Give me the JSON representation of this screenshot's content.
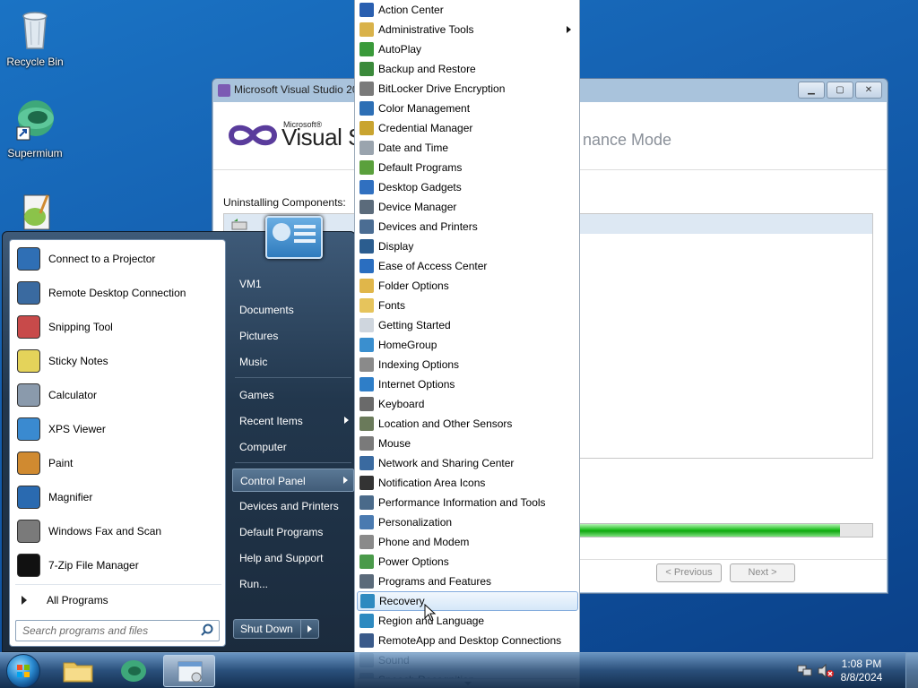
{
  "desktop": {
    "icons": [
      {
        "label": "Recycle Bin",
        "icon": "recycle-bin-icon"
      },
      {
        "label": "Supermium",
        "icon": "supermium-icon"
      }
    ]
  },
  "vs_window": {
    "title": "Microsoft Visual Studio 20",
    "logo_sup": "Microsoft®",
    "logo_text": "Visual St",
    "mode_text": "nance Mode",
    "section_label": "Uninstalling Components:",
    "progress": 0.95,
    "prev_button": "< Previous",
    "next_button": "Next >"
  },
  "start_menu": {
    "programs": [
      {
        "label": "Connect to a Projector",
        "icon": "projector-icon"
      },
      {
        "label": "Remote Desktop Connection",
        "icon": "remote-desktop-icon"
      },
      {
        "label": "Snipping Tool",
        "icon": "scissors-icon"
      },
      {
        "label": "Sticky Notes",
        "icon": "sticky-notes-icon"
      },
      {
        "label": "Calculator",
        "icon": "calculator-icon"
      },
      {
        "label": "XPS Viewer",
        "icon": "xps-viewer-icon"
      },
      {
        "label": "Paint",
        "icon": "paint-icon"
      },
      {
        "label": "Magnifier",
        "icon": "magnifier-icon"
      },
      {
        "label": "Windows Fax and Scan",
        "icon": "fax-icon"
      },
      {
        "label": "7-Zip File Manager",
        "icon": "7zip-icon"
      }
    ],
    "all_programs": "All Programs",
    "search_placeholder": "Search programs and files",
    "right_items": [
      {
        "label": "VM1"
      },
      {
        "label": "Documents"
      },
      {
        "label": "Pictures"
      },
      {
        "label": "Music"
      },
      {
        "label": "Games"
      },
      {
        "label": "Recent Items"
      },
      {
        "label": "Computer"
      },
      {
        "label": "Control Panel"
      },
      {
        "label": "Devices and Printers"
      },
      {
        "label": "Default Programs"
      },
      {
        "label": "Help and Support"
      },
      {
        "label": "Run..."
      }
    ],
    "shutdown": "Shut Down"
  },
  "control_panel_menu": {
    "items": [
      {
        "label": "Action Center",
        "color": "#2a5fb0"
      },
      {
        "label": "Administrative Tools",
        "color": "#d9b24a"
      },
      {
        "label": "AutoPlay",
        "color": "#3a9a3a"
      },
      {
        "label": "Backup and Restore",
        "color": "#3b8a3b"
      },
      {
        "label": "BitLocker Drive Encryption",
        "color": "#7a7a7a"
      },
      {
        "label": "Color Management",
        "color": "#2d6fb5"
      },
      {
        "label": "Credential Manager",
        "color": "#c9a430"
      },
      {
        "label": "Date and Time",
        "color": "#9aa4ae"
      },
      {
        "label": "Default Programs",
        "color": "#5aa03c"
      },
      {
        "label": "Desktop Gadgets",
        "color": "#3070c0"
      },
      {
        "label": "Device Manager",
        "color": "#5b6b7b"
      },
      {
        "label": "Devices and Printers",
        "color": "#4b6d93"
      },
      {
        "label": "Display",
        "color": "#2b5d8f"
      },
      {
        "label": "Ease of Access Center",
        "color": "#2a6ec0"
      },
      {
        "label": "Folder Options",
        "color": "#e0b64a"
      },
      {
        "label": "Fonts",
        "color": "#e6c45c"
      },
      {
        "label": "Getting Started",
        "color": "#cfd6de"
      },
      {
        "label": "HomeGroup",
        "color": "#3a8fcf"
      },
      {
        "label": "Indexing Options",
        "color": "#8a8a8a"
      },
      {
        "label": "Internet Options",
        "color": "#2e7ec8"
      },
      {
        "label": "Keyboard",
        "color": "#6a6a6a"
      },
      {
        "label": "Location and Other Sensors",
        "color": "#6a7a5a"
      },
      {
        "label": "Mouse",
        "color": "#7a7a7a"
      },
      {
        "label": "Network and Sharing Center",
        "color": "#3a6aa0"
      },
      {
        "label": "Notification Area Icons",
        "color": "#333333"
      },
      {
        "label": "Performance Information and Tools",
        "color": "#4a6a8a"
      },
      {
        "label": "Personalization",
        "color": "#4a7ab0"
      },
      {
        "label": "Phone and Modem",
        "color": "#8a8a8a"
      },
      {
        "label": "Power Options",
        "color": "#4a9a4a"
      },
      {
        "label": "Programs and Features",
        "color": "#5a6a7a"
      },
      {
        "label": "Recovery",
        "color": "#2e8ac0"
      },
      {
        "label": "Region and Language",
        "color": "#2e8ac0"
      },
      {
        "label": "RemoteApp and Desktop Connections",
        "color": "#3a5a8a"
      },
      {
        "label": "Sound",
        "color": "#9aa4ae"
      },
      {
        "label": "Speech Recognition",
        "color": "#9aa4ae"
      }
    ],
    "highlighted": "Recovery"
  },
  "taskbar": {
    "time": "1:08 PM",
    "date": "8/8/2024"
  }
}
